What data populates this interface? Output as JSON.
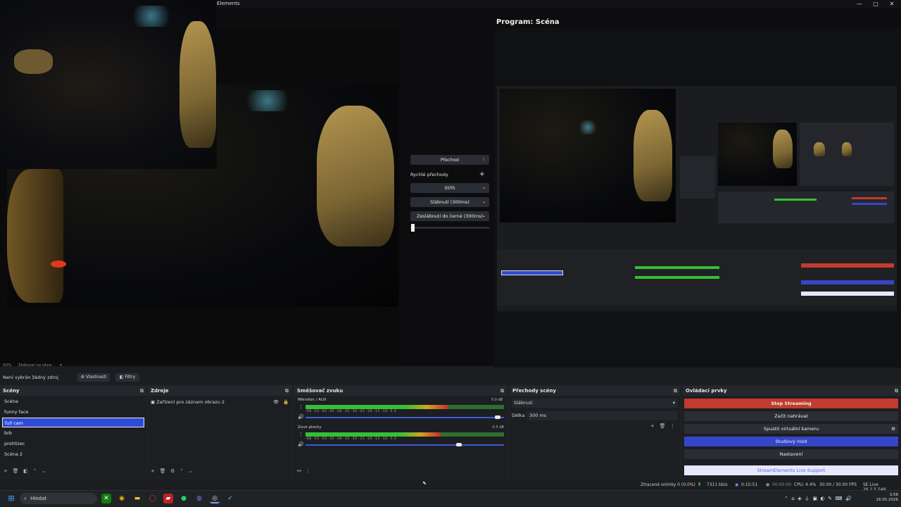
{
  "window": {
    "title": "Elements",
    "controls": [
      "—",
      "▢",
      "✕"
    ]
  },
  "program": {
    "label": "Program: Scéna"
  },
  "preview": {
    "zoom": "50%",
    "zoom_mode": "Škálovat na okno"
  },
  "transitions_panel": {
    "transition_button": "Přechod",
    "quick_transitions_label": "Rychlé přechody",
    "items": [
      "Střih",
      "Slábnutí (300ms)",
      "Zeslábnutí do černé (300ms)"
    ]
  },
  "source_toolbar": {
    "no_source": "Není vybrán žádný zdroj",
    "properties": "Vlastnosti",
    "filters": "Filtry"
  },
  "scenes": {
    "title": "Scény",
    "items": [
      "Scéna",
      "funny face",
      "full cam",
      "brb",
      "prohlizec",
      "Scéna 2"
    ],
    "selected_index": 2
  },
  "sources": {
    "title": "Zdroje",
    "items": [
      "Zařízení pro záznam obrazu 2"
    ]
  },
  "mixer": {
    "title": "Směšovač zvuku",
    "channels": [
      {
        "name": "Mikrofon / AUX",
        "db": "0.0 dB",
        "level": 0.72,
        "volume": 0.98
      },
      {
        "name": "Zvuk plochy",
        "db": "-5.5 dB",
        "level": 0.68,
        "volume": 0.78
      }
    ],
    "ticks": "-60 -55 -50 -45 -40 -35 -30 -25 -20 -15 -10 -5 0"
  },
  "scene_transitions": {
    "title": "Přechody scény",
    "selected": "Slábnutí",
    "duration_label": "Délka",
    "duration_value": "300 ms"
  },
  "controls": {
    "title": "Ovládací prvky",
    "stop_streaming": "Stop Streaming",
    "start_recording": "Začít nahrávat",
    "virtual_camera": "Spustit virtuální kameru",
    "studio_mode": "Studiový mód",
    "settings": "Nastavení",
    "support": "StreamElements Live Support"
  },
  "status": {
    "dropped_frames": "Ztracené snímky 0 (0.0%)",
    "bitrate": "7311 kb/s",
    "stream_time": "0:15:51",
    "rec_time": "00:00:00",
    "cpu": "CPU: 4.4%",
    "fps": "30.00 / 30.00 FPS",
    "version": "SE.Live 26.2.5.549"
  },
  "taskbar": {
    "search_placeholder": "Hledat",
    "time": "3:58",
    "date": "16.05.2026"
  },
  "colors": {
    "stop": "#c23b2e",
    "studio": "#3546c8",
    "selection": "#2f4ad6"
  }
}
